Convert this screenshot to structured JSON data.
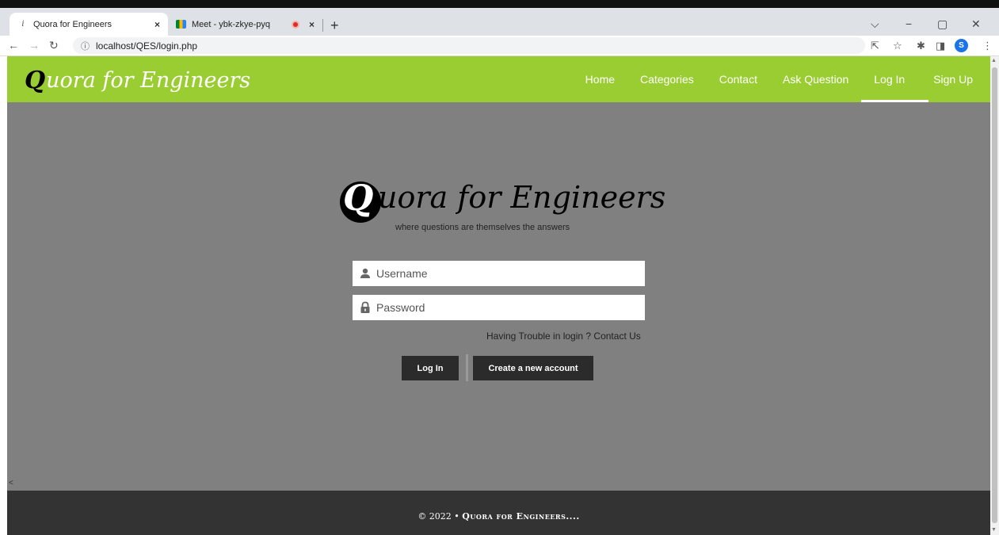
{
  "browser": {
    "tabs": [
      {
        "title": "Quora for Engineers",
        "favicon": "i",
        "close": "×"
      },
      {
        "title": "Meet - ybk-zkye-pyq",
        "close": "×"
      }
    ],
    "new_tab": "+",
    "url": "localhost/QES/login.php",
    "profile_initial": "S"
  },
  "header": {
    "brand_initial": "Q",
    "brand_rest": "uora for Engineers",
    "nav": [
      {
        "label": "Home"
      },
      {
        "label": "Categories"
      },
      {
        "label": "Contact"
      },
      {
        "label": "Ask Question"
      },
      {
        "label": "Log In",
        "active": true
      },
      {
        "label": "Sign Up"
      }
    ]
  },
  "login": {
    "logo_initial": "Q",
    "logo_text": "uora for Engineers",
    "tagline": "where questions are themselves the answers",
    "username_placeholder": "Username",
    "password_placeholder": "Password",
    "trouble_text": "Having Trouble in login ? Contact Us",
    "login_button": "Log In",
    "create_button": "Create a new account"
  },
  "footer": {
    "copyright_prefix": "© 2022 •",
    "copyright_brand": "Quora for Engineers...."
  },
  "colors": {
    "header_bg": "#9acd32",
    "main_bg": "#808080",
    "footer_bg": "#333333",
    "button_bg": "#2b2b2b"
  }
}
